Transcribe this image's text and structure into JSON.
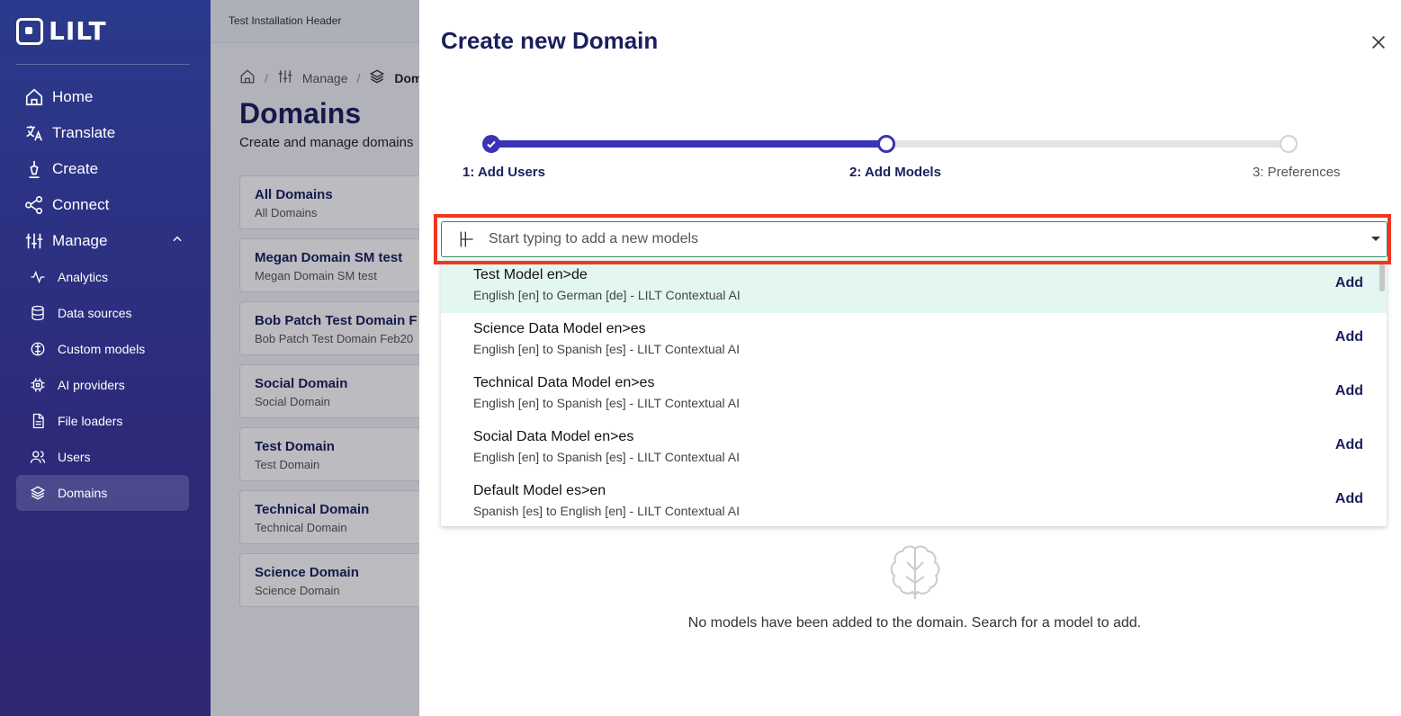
{
  "brand": {
    "name": "LILT"
  },
  "sidebar": {
    "primary": [
      {
        "label": "Home",
        "icon": "home-icon"
      },
      {
        "label": "Translate",
        "icon": "translate-icon"
      },
      {
        "label": "Create",
        "icon": "pen-icon"
      },
      {
        "label": "Connect",
        "icon": "share-icon"
      },
      {
        "label": "Manage",
        "icon": "sliders-icon",
        "expanded": true
      }
    ],
    "manage_items": [
      {
        "label": "Analytics",
        "icon": "activity-icon"
      },
      {
        "label": "Data sources",
        "icon": "database-icon"
      },
      {
        "label": "Custom models",
        "icon": "model-icon"
      },
      {
        "label": "AI providers",
        "icon": "chip-icon"
      },
      {
        "label": "File loaders",
        "icon": "file-icon"
      },
      {
        "label": "Users",
        "icon": "users-icon"
      },
      {
        "label": "Domains",
        "icon": "layers-icon",
        "active": true
      }
    ]
  },
  "background": {
    "header": "Test Installation Header",
    "breadcrumb": {
      "manage": "Manage",
      "current": "Dom"
    },
    "title": "Domains",
    "subtitle": "Create and manage domains",
    "domains": [
      {
        "title": "All Domains",
        "sub": "All Domains"
      },
      {
        "title": "Megan Domain SM test",
        "sub": "Megan Domain SM test"
      },
      {
        "title": "Bob Patch Test Domain F",
        "sub": "Bob Patch Test Domain Feb20"
      },
      {
        "title": "Social Domain",
        "sub": "Social Domain"
      },
      {
        "title": "Test Domain",
        "sub": "Test Domain"
      },
      {
        "title": "Technical Domain",
        "sub": "Technical Domain"
      },
      {
        "title": "Science Domain",
        "sub": "Science Domain"
      }
    ]
  },
  "modal": {
    "title": "Create new Domain",
    "steps": [
      {
        "label": "1: Add Users",
        "state": "done"
      },
      {
        "label": "2: Add Models",
        "state": "current"
      },
      {
        "label": "3: Preferences",
        "state": "future"
      }
    ],
    "progress_fraction": 0.5,
    "search": {
      "placeholder": "Start typing to add a new models",
      "value": ""
    },
    "models": [
      {
        "name": "Test Model en>de",
        "desc": "English [en] to German [de] - LILT Contextual AI",
        "action": "Add",
        "highlighted": true
      },
      {
        "name": "Science Data Model en>es",
        "desc": "English [en] to Spanish [es] - LILT Contextual AI",
        "action": "Add"
      },
      {
        "name": "Technical Data Model en>es",
        "desc": "English [en] to Spanish [es] - LILT Contextual AI",
        "action": "Add"
      },
      {
        "name": "Social Data Model en>es",
        "desc": "English [en] to Spanish [es] - LILT Contextual AI",
        "action": "Add"
      },
      {
        "name": "Default Model es>en",
        "desc": "Spanish [es] to English [en] - LILT Contextual AI",
        "action": "Add"
      }
    ],
    "empty_state": "No models have been added to the domain. Search for a model to add."
  },
  "colors": {
    "accent": "#3a33b5",
    "navy": "#1a1f5c",
    "highlight_box": "#f0361e",
    "row_highlight": "#e3f6f1"
  }
}
